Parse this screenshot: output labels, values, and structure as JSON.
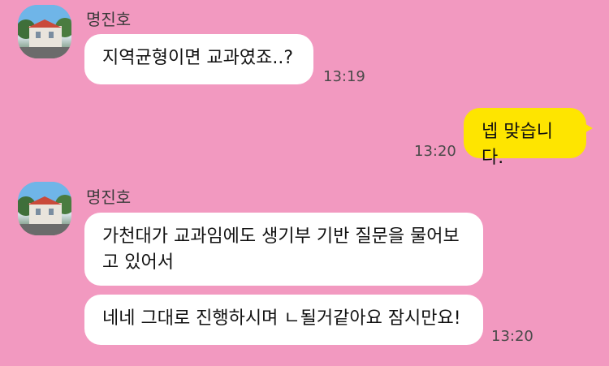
{
  "messages": [
    {
      "sender": "명진호",
      "text": "지역균형이면 교과였죠..?",
      "time": "13:19"
    },
    {
      "text": "넵 맞습니다.",
      "time": "13:20"
    },
    {
      "sender": "명진호",
      "text": "가천대가 교과임에도 생기부 기반 질문을 물어보고 있어서",
      "text_line1": "가천대가 교과임에도 생기부 기반 질문을 물어보",
      "text_line2": "고 있어서"
    },
    {
      "text": "네네 그대로 진행하시며 ㄴ될거같아요 잠시만요!",
      "time": "13:20"
    }
  ],
  "colors": {
    "background": "#f299c0",
    "my_bubble": "#fee500",
    "their_bubble": "#ffffff"
  },
  "icons": {
    "avatar": "profile-photo-building"
  }
}
